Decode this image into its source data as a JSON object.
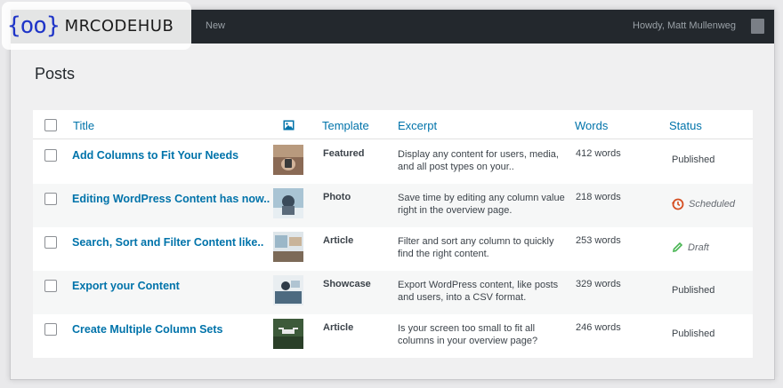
{
  "adminbar": {
    "new_label": "New",
    "howdy": "Howdy, Matt Mullenweg"
  },
  "logo": {
    "mark": "{oo}",
    "text": "MRCODEHUB"
  },
  "page": {
    "title": "Posts"
  },
  "table": {
    "columns": {
      "title": "Title",
      "template": "Template",
      "excerpt": "Excerpt",
      "words": "Words",
      "status": "Status"
    },
    "rows": [
      {
        "title": "Add Columns to Fit Your Needs",
        "template": "Featured",
        "excerpt": "Display any content for users, media, and all post types on your..",
        "words": "412 words",
        "status": "Published",
        "status_kind": "published"
      },
      {
        "title": "Editing WordPress Content has now..",
        "template": "Photo",
        "excerpt": "Save time by editing any column value right in the overview page.",
        "words": "218 words",
        "status": "Scheduled",
        "status_kind": "scheduled"
      },
      {
        "title": "Search, Sort and Filter Content like..",
        "template": "Article",
        "excerpt": "Filter and sort any column to quickly find the right content.",
        "words": "253 words",
        "status": "Draft",
        "status_kind": "draft"
      },
      {
        "title": "Export your Content",
        "template": "Showcase",
        "excerpt": "Export WordPress content, like posts and users, into a CSV format.",
        "words": "329 words",
        "status": "Published",
        "status_kind": "published"
      },
      {
        "title": "Create Multiple Column Sets",
        "template": "Article",
        "excerpt": "Is your screen too small to fit all columns in your overview page?",
        "words": "246 words",
        "status": "Published",
        "status_kind": "published"
      }
    ]
  },
  "icons": {
    "image_column": "image-icon",
    "scheduled": "clock-history-icon",
    "draft": "pencil-icon"
  },
  "colors": {
    "link": "#0073aa",
    "adminbar": "#23282d",
    "scheduled": "#d54e21",
    "draft": "#46b450",
    "logo": "#1f35c8"
  }
}
